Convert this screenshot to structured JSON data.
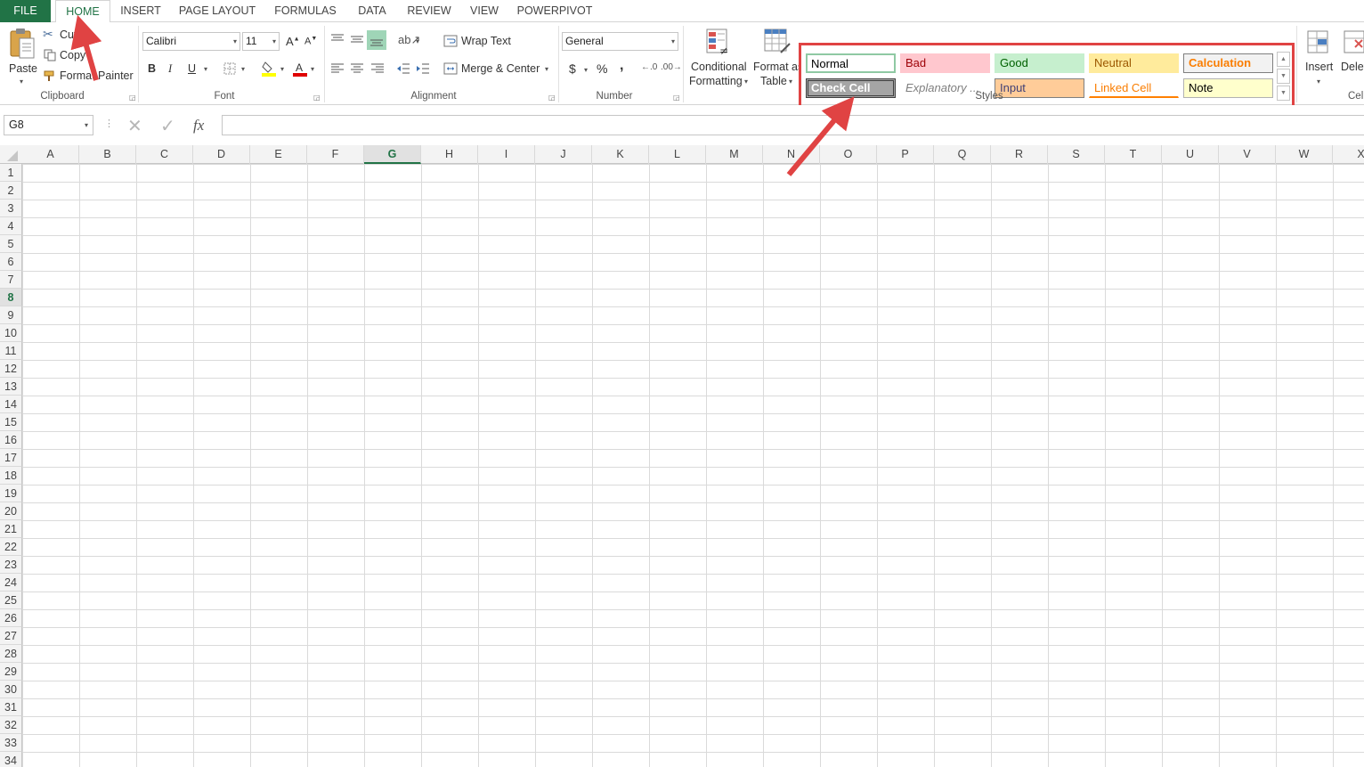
{
  "tabs": [
    {
      "label": "FILE"
    },
    {
      "label": "HOME"
    },
    {
      "label": "INSERT"
    },
    {
      "label": "PAGE LAYOUT"
    },
    {
      "label": "FORMULAS"
    },
    {
      "label": "DATA"
    },
    {
      "label": "REVIEW"
    },
    {
      "label": "VIEW"
    },
    {
      "label": "POWERPIVOT"
    }
  ],
  "clipboard": {
    "paste": "Paste",
    "cut": "Cut",
    "copy": "Copy",
    "format_painter": "Format Painter",
    "label": "Clipboard"
  },
  "font": {
    "name": "Calibri",
    "size": "11",
    "bold": "B",
    "italic": "I",
    "underline": "U",
    "label": "Font"
  },
  "alignment": {
    "wrap_text": "Wrap Text",
    "merge_center": "Merge & Center",
    "label": "Alignment"
  },
  "number": {
    "format": "General",
    "currency": "$",
    "percent": "%",
    "comma": ",",
    "label": "Number"
  },
  "styles": {
    "conditional_1": "Conditional",
    "conditional_2": "Formatting",
    "format_table_1": "Format as",
    "format_table_2": "Table",
    "label": "Styles",
    "gallery": [
      {
        "label": "Normal",
        "bg": "#ffffff",
        "color": "#000000"
      },
      {
        "label": "Bad",
        "bg": "#ffc7ce",
        "color": "#9c0006"
      },
      {
        "label": "Good",
        "bg": "#c6efce",
        "color": "#006100"
      },
      {
        "label": "Neutral",
        "bg": "#ffeb9c",
        "color": "#9c5700"
      },
      {
        "label": "Calculation",
        "bg": "#f2f2f2",
        "color": "#fa7d00"
      },
      {
        "label": "Check Cell",
        "bg": "#a5a5a5",
        "color": "#ffffff"
      },
      {
        "label": "Explanatory ...",
        "bg": "#ffffff",
        "color": "#7f7f7f"
      },
      {
        "label": "Input",
        "bg": "#ffcc99",
        "color": "#3f3f76"
      },
      {
        "label": "Linked Cell",
        "bg": "#ffffff",
        "color": "#fa7d00"
      },
      {
        "label": "Note",
        "bg": "#ffffcc",
        "color": "#000000"
      }
    ]
  },
  "cells_group": {
    "insert": "Insert",
    "delete": "Delete",
    "label": "Cells"
  },
  "formula_bar": {
    "name_box": "G8",
    "fx": "fx",
    "formula": ""
  },
  "grid": {
    "columns": [
      "A",
      "B",
      "C",
      "D",
      "E",
      "F",
      "G",
      "H",
      "I",
      "J",
      "K",
      "L",
      "M",
      "N",
      "O",
      "P",
      "Q",
      "R",
      "S",
      "T",
      "U",
      "V",
      "W",
      "X"
    ],
    "rows": [
      "1",
      "2",
      "3",
      "4",
      "5",
      "6",
      "7",
      "8",
      "9",
      "10",
      "11",
      "12",
      "13",
      "14",
      "15",
      "16",
      "17",
      "18",
      "19",
      "20",
      "21",
      "22",
      "23",
      "24",
      "25",
      "26",
      "27",
      "28",
      "29",
      "30",
      "31",
      "32",
      "33",
      "34"
    ],
    "selected_column": "G",
    "selected_row": "8"
  },
  "colors": {
    "excel_green": "#217346",
    "highlight_red": "#e04343"
  }
}
